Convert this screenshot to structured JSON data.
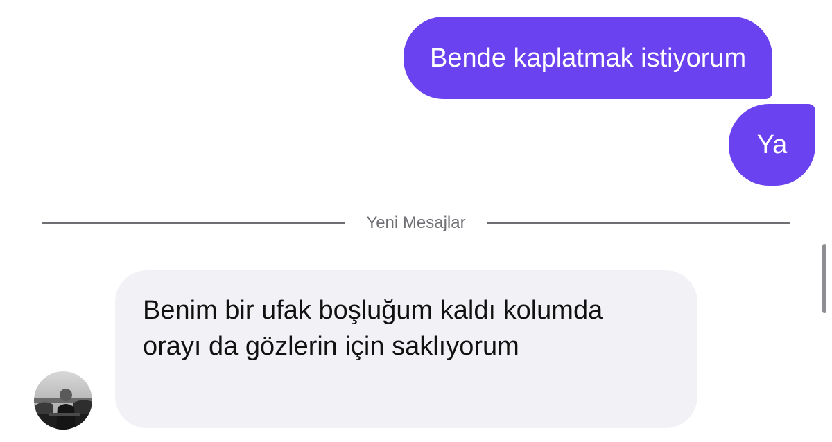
{
  "messages": {
    "outgoing": [
      {
        "text": "Bende kaplatmak istiyorum"
      },
      {
        "text": "Ya"
      }
    ],
    "divider_label": "Yeni Mesajlar",
    "incoming": {
      "lines": [
        "Benim bir ufak boşluğum kaldı kolumda",
        "orayı da gözlerin için saklıyorum"
      ]
    }
  },
  "colors": {
    "outgoing_bubble": "#6b42f0",
    "incoming_bubble": "#f2f2f6",
    "divider": "#6e6e73"
  },
  "icons": {
    "avatar": "user-avatar-photo"
  }
}
